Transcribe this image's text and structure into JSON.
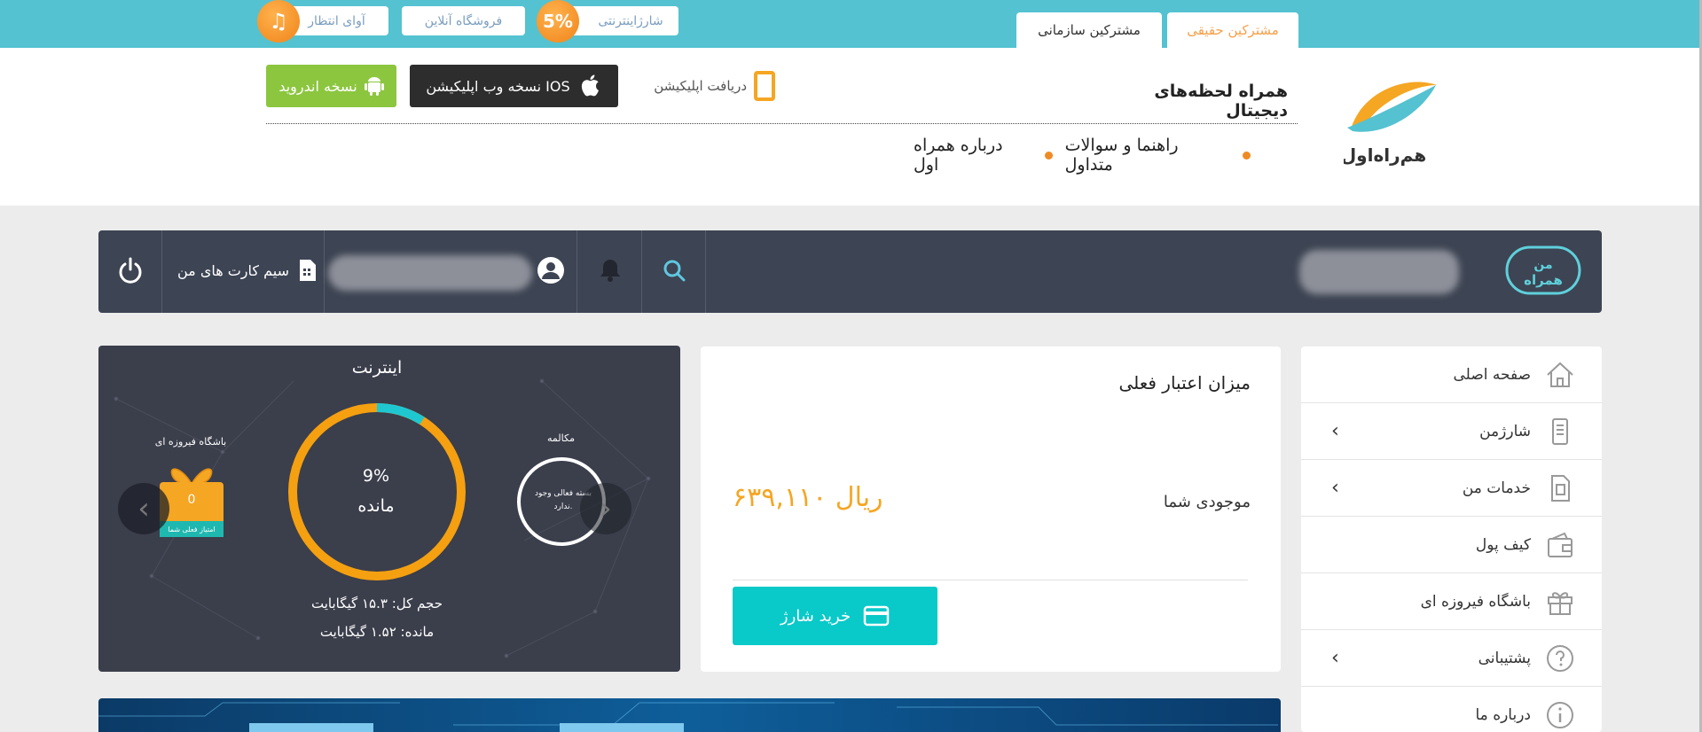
{
  "top_bar": {
    "tabs": [
      {
        "label": "مشترکین حقیقی"
      },
      {
        "label": "مشترکین سازمانی"
      }
    ],
    "pills": {
      "internet_charge": "شارژاینترنتی",
      "internet_charge_badge": "5%",
      "online_shop": "فروشگاه آنلاین",
      "waiting_tone": "آوای انتظار",
      "waiting_tone_icon": "♫"
    }
  },
  "header": {
    "tagline": "همراه لحظه‌های دیجیتال",
    "nav_links": [
      "راهنما و سوالات متداول",
      "درباره همراه اول"
    ],
    "get_app_label": "دریافت اپلیکیشن",
    "ios_button": "نسخه وب اپلیکیشن IOS",
    "android_button": "نسخه اندروید",
    "brand_colors": {
      "cyan": "#54c2d0",
      "orange": "#f5a623",
      "green": "#8cc63f"
    }
  },
  "user_bar": {
    "sim_cards_label": "سیم کارت های من",
    "icons": [
      "power-icon",
      "sim-card-icon",
      "user-icon",
      "bell-icon",
      "search-icon"
    ]
  },
  "sidebar": {
    "items": [
      {
        "label": "صفحه اصلی",
        "icon": "home-icon",
        "has_chevron": false
      },
      {
        "label": "شارژمن",
        "icon": "phone-charge-icon",
        "has_chevron": true
      },
      {
        "label": "خدمات من",
        "icon": "services-icon",
        "has_chevron": true
      },
      {
        "label": "کیف پول",
        "icon": "wallet-icon",
        "has_chevron": false
      },
      {
        "label": "باشگاه فیروزه ای",
        "icon": "gift-icon",
        "has_chevron": false
      },
      {
        "label": "پشتیبانی",
        "icon": "question-icon",
        "has_chevron": true
      },
      {
        "label": "درباره ما",
        "icon": "info-icon",
        "has_chevron": false
      }
    ]
  },
  "credit": {
    "title": "میزان اعتبار فعلی",
    "balance_label": "موجودی شما",
    "balance_value": "۶۳۹,۱۱۰ ریال",
    "buy_button": "خرید شارژ"
  },
  "internet": {
    "title": "اینترنت",
    "remaining_percent_label": "9%",
    "remaining_word": "مانده",
    "remaining_fraction": 0.09,
    "total": "حجم کل: ۱۵.۳ گیگابایت",
    "remaining": "مانده: ۱.۵۲ گیگابایت",
    "calls_title": "مکالمه",
    "calls_text": "بسته فعالی وجود ندارد.",
    "club_title": "باشگاه فیروزه ای",
    "club_points": "0",
    "club_band": "امتیاز فعلی شما"
  }
}
